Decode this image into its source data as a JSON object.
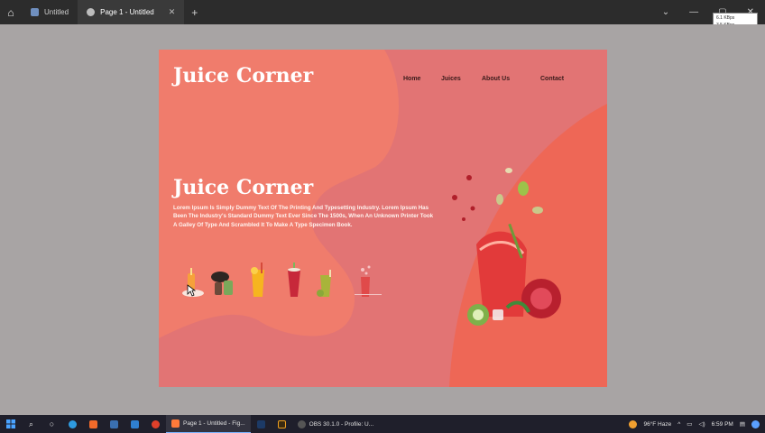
{
  "titlebar": {
    "tabs": [
      {
        "label": "Untitled",
        "icon": "figma-file-icon",
        "active": false
      },
      {
        "label": "Page 1 - Untitled",
        "icon": "play-icon",
        "active": true
      }
    ],
    "new_tab": "+",
    "netstat": [
      "6.1 KBps",
      "3.5 KBps"
    ]
  },
  "page": {
    "brand": "Juice Corner",
    "nav": [
      "Home",
      "Juices",
      "About Us",
      "Contact"
    ],
    "hero_title": "Juice Corner",
    "hero_text": "Lorem Ipsum Is Simply Dummy Text Of The Printing And Typesetting Industry. Lorem Ipsum Has Been The Industry's Standard Dummy Text Ever Since The 1500s, When An Unknown Printer Took A Galley Of Type And Scrambled It To Make A Type Specimen Book.",
    "thumbnails": [
      "orange-juice",
      "coffee-pour",
      "orange-glass",
      "strawberry-drink",
      "green-smoothie",
      "berry-juice"
    ],
    "colors": {
      "frame": "#e27474",
      "blob": "#f07a6a",
      "accent": "#ee6655"
    }
  },
  "taskbar": {
    "apps": [
      {
        "label": "Page 1 - Untitled - Fig...",
        "icon": "figma-icon",
        "active": true
      },
      {
        "label": "OBS 30.1.0 - Profile: U...",
        "icon": "obs-icon",
        "active": false
      }
    ],
    "weather": "96°F  Haze",
    "time": "6:59 PM"
  }
}
